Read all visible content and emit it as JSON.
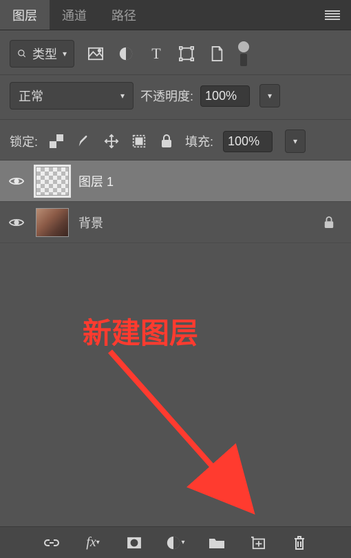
{
  "tabs": {
    "layers": "图层",
    "channels": "通道",
    "paths": "路径"
  },
  "filter": {
    "label": "类型"
  },
  "blend": {
    "mode": "正常",
    "opacity_label": "不透明度:",
    "opacity_value": "100%"
  },
  "lock": {
    "label": "锁定:",
    "fill_label": "填充:",
    "fill_value": "100%"
  },
  "layers_list": [
    {
      "name": "图层 1",
      "locked": false,
      "selected": true,
      "thumb": "checker"
    },
    {
      "name": "背景",
      "locked": true,
      "selected": false,
      "thumb": "portrait"
    }
  ],
  "annotation": {
    "text": "新建图层"
  },
  "icons": {
    "image": "image-icon",
    "adjust": "adjust-icon",
    "type": "type-icon",
    "shape": "shape-icon",
    "smart": "smart-object-icon",
    "link": "link-icon",
    "fx": "fx-icon",
    "mask": "mask-icon",
    "adjlayer": "adjustment-layer-icon",
    "group": "group-icon",
    "new": "new-layer-icon",
    "trash": "trash-icon"
  }
}
